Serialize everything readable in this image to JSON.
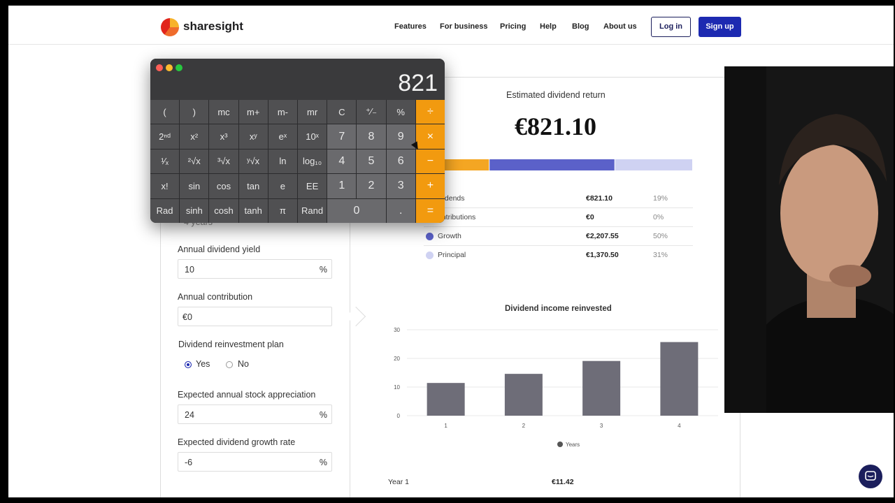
{
  "header": {
    "logo_text": "sharesight",
    "nav": [
      "Features",
      "For business",
      "Pricing",
      "Help",
      "Blog",
      "About us"
    ],
    "login_label": "Log in",
    "signup_label": "Sign up"
  },
  "form": {
    "hidden_value": "4 years",
    "yield_label": "Annual dividend yield",
    "yield_value": "10",
    "yield_unit": "%",
    "contribution_label": "Annual contribution",
    "contribution_value": "€0",
    "drip_label": "Dividend reinvestment plan",
    "drip_options": [
      "Yes",
      "No"
    ],
    "drip_selected": "Yes",
    "appreciation_label": "Expected annual stock appreciation",
    "appreciation_value": "24",
    "appreciation_unit": "%",
    "growth_label": "Expected dividend growth rate",
    "growth_value": "-6",
    "growth_unit": "%"
  },
  "results": {
    "title": "Estimated dividend return",
    "value": "€821.10",
    "breakdown": [
      {
        "name": "Dividends",
        "shown": "ividends",
        "value": "€821.10",
        "pct": "19%",
        "color": "#f4a623"
      },
      {
        "name": "Contributions",
        "shown": "ontributions",
        "value": "€0",
        "pct": "0%",
        "color": "#3aa6a0"
      },
      {
        "name": "Growth",
        "shown": "Growth",
        "value": "€2,207.55",
        "pct": "50%",
        "color": "#5b61c9"
      },
      {
        "name": "Principal",
        "shown": "Principal",
        "value": "€1,370.50",
        "pct": "31%",
        "color": "#cfd2f2"
      }
    ],
    "year_row": {
      "label": "Year 1",
      "value": "€11.42"
    }
  },
  "chart_data": {
    "type": "bar",
    "title": "Dividend income reinvested",
    "categories": [
      "1",
      "2",
      "3",
      "4"
    ],
    "values": [
      11.42,
      14.6,
      19.1,
      25.7
    ],
    "ylim": [
      0,
      30
    ],
    "yticks": [
      0,
      10,
      20,
      30
    ],
    "legend": "Years",
    "legend_position": "bottom",
    "color": "#6e6d78",
    "grid": true
  },
  "calculator": {
    "display": "821",
    "traffic_colors": [
      "#ff5f57",
      "#febc2e",
      "#28c840"
    ],
    "keys": [
      [
        "(",
        ")",
        "mc",
        "m+",
        "m-",
        "mr",
        "C",
        "⁺∕₋",
        "%",
        "÷"
      ],
      [
        "2ⁿᵈ",
        "x²",
        "x³",
        "xʸ",
        "eˣ",
        "10ˣ",
        "7",
        "8",
        "9",
        "×"
      ],
      [
        "¹⁄ₓ",
        "²√x",
        "³√x",
        "ʸ√x",
        "ln",
        "log₁₀",
        "4",
        "5",
        "6",
        "−"
      ],
      [
        "x!",
        "sin",
        "cos",
        "tan",
        "e",
        "EE",
        "1",
        "2",
        "3",
        "+"
      ],
      [
        "Rad",
        "sinh",
        "cosh",
        "tanh",
        "π",
        "Rand",
        "0",
        ".",
        "="
      ]
    ]
  }
}
